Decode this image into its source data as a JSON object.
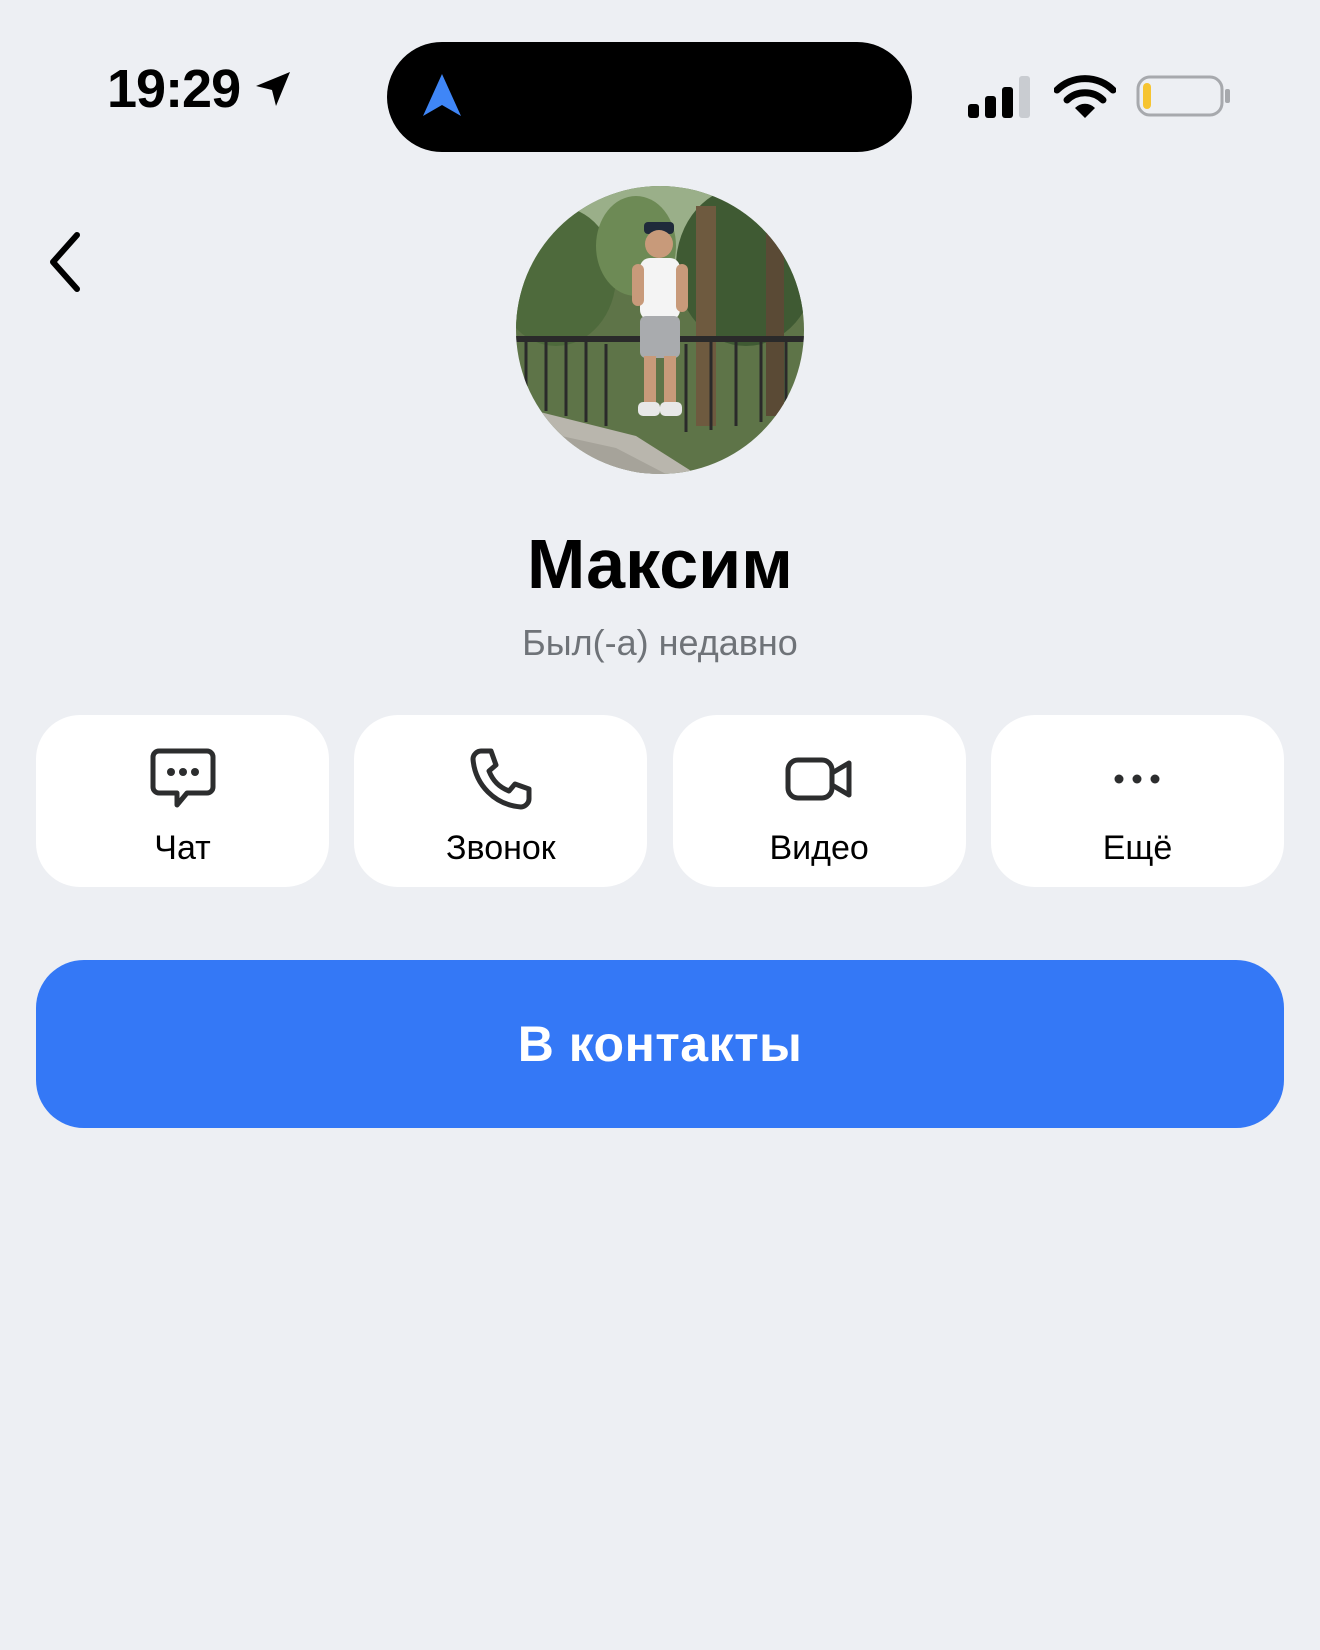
{
  "status_bar": {
    "time": "19:29",
    "battery_color": "#F6C431"
  },
  "profile": {
    "name": "Максим",
    "status": "Был(-а) недавно"
  },
  "actions": [
    {
      "label": "Чат",
      "icon": "chat-bubble-icon"
    },
    {
      "label": "Звонок",
      "icon": "phone-icon"
    },
    {
      "label": "Видео",
      "icon": "video-camera-icon"
    },
    {
      "label": "Ещё",
      "icon": "more-dots-icon"
    }
  ],
  "primary_button": {
    "label": "В контакты",
    "color": "#3478F6"
  }
}
